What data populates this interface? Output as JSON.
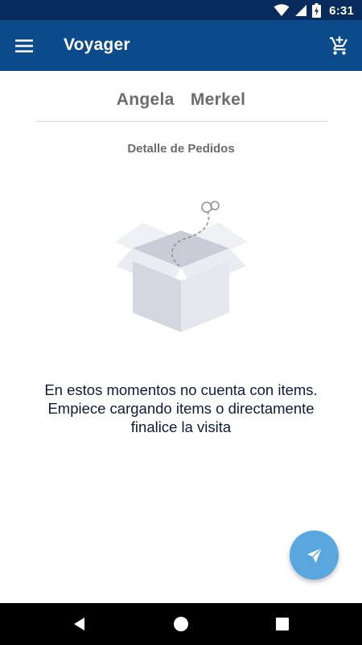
{
  "status_bar": {
    "time": "6:31",
    "icons": [
      "wifi-icon",
      "cell-signal-icon",
      "battery-charging-icon"
    ]
  },
  "app_bar": {
    "title": "Voyager",
    "menu_icon": "menu-icon",
    "cart_icon": "add-to-cart-icon"
  },
  "main": {
    "customer_name": "Angela  Merkel",
    "section_title": "Detalle de Pedidos",
    "empty_message": {
      "line1": "En estos momentos no cuenta con items.",
      "line2": "Empiece cargando items o directamente",
      "line3": "finalice la visita"
    },
    "illustration": "empty-box-icon"
  },
  "fab": {
    "icon": "send-icon",
    "color": "#5aa7e0"
  },
  "nav_bar": {
    "icons": [
      "back-icon",
      "home-icon",
      "recents-icon"
    ]
  },
  "colors": {
    "status_bar": "#062b5c",
    "app_bar": "#0b4a8b",
    "text_gray": "#6c6c6c",
    "text_dark": "#0d1b3e"
  }
}
